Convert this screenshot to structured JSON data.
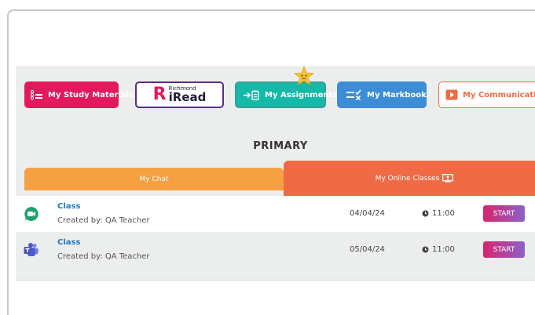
{
  "nav": {
    "study_label": "My Study Materials",
    "iread_brand_small": "Richmond",
    "iread_brand_big": "iRead",
    "iread_brand_r": "R",
    "assignments_label": "My Assignments",
    "markbook_label": "My Markbook",
    "communications_label": "My Communications"
  },
  "section": {
    "title": "PRIMARY"
  },
  "tabs": {
    "chat_label": "My Chat",
    "online_label": "My Online Classes"
  },
  "classes": [
    {
      "title": "Class",
      "created_by": "Created by: QA Teacher",
      "date": "04/04/24",
      "time": "11:00",
      "start_label": "START",
      "platform_icon": "google-meet-icon"
    },
    {
      "title": "Class",
      "created_by": "Created by: QA Teacher",
      "date": "05/04/24",
      "time": "11:00",
      "start_label": "START",
      "platform_icon": "microsoft-teams-icon"
    }
  ],
  "colors": {
    "study": "#e2195b",
    "assignments": "#16b8a8",
    "markbook": "#3d8dd6",
    "communications": "#ef6b45",
    "chat_tab": "#f5a043",
    "online_tab": "#ef6b45",
    "link": "#1f7bc2"
  }
}
